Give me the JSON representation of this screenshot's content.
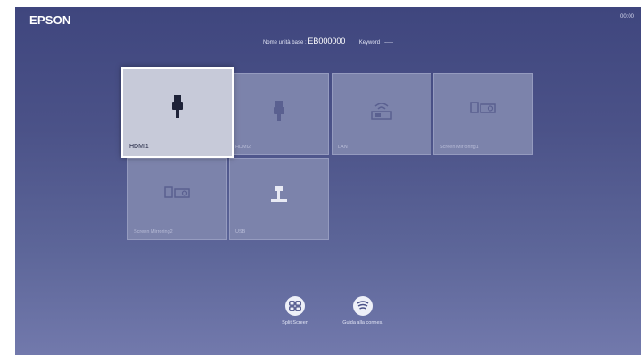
{
  "header": {
    "brand": "EPSON",
    "clock": "00:00",
    "unit_label": "Nome unità base :",
    "unit_code": "EB000000",
    "keyword_label": "Keyword :",
    "keyword_value": "-----"
  },
  "sources": [
    {
      "label": "HDMI1",
      "icon": "hdmi-icon",
      "selected": true
    },
    {
      "label": "HDMI2",
      "icon": "hdmi-icon",
      "selected": false
    },
    {
      "label": "LAN",
      "icon": "lan-icon",
      "selected": false
    },
    {
      "label": "Screen Mirroring1",
      "icon": "screen-mirroring-icon",
      "selected": false
    },
    {
      "label": "Screen Mirroring2",
      "icon": "screen-mirroring-icon",
      "selected": false
    },
    {
      "label": "USB",
      "icon": "usb-icon",
      "selected": false
    }
  ],
  "actions": {
    "split_screen": "Split Screen",
    "connection_guide": "Guida alla connes."
  },
  "colors": {
    "background_top": "#3f467e",
    "background_bottom": "#7279ac",
    "tile": "#7c83ab",
    "tile_selected": "#c7cad9"
  }
}
